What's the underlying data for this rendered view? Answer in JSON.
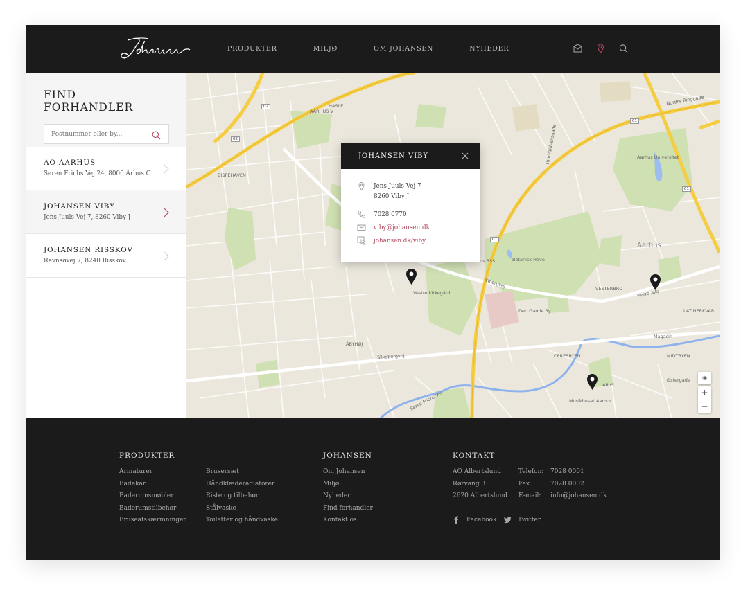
{
  "header": {
    "logo_text": "Johansen",
    "nav": [
      "PRODUKTER",
      "MILJØ",
      "OM JOHANSEN",
      "NYHEDER"
    ],
    "icons": [
      "mail-icon",
      "location-pin-icon",
      "search-icon"
    ],
    "accent_color": "#b2475c"
  },
  "sidebar": {
    "title": "FIND FORHANDLER",
    "search_placeholder": "Postnummer eller by...",
    "dealers": [
      {
        "name": "AO AARHUS",
        "address": "Søren Frichs Vej 24, 8000 Århus C"
      },
      {
        "name": "JOHANSEN VIBY",
        "address": "Jens Juuls Vej 7, 8260 Viby J"
      },
      {
        "name": "JOHANSEN RISSKOV",
        "address": "Ravnsøvej 7, 8240 Risskov"
      }
    ]
  },
  "popup": {
    "title": "JOHANSEN VIBY",
    "street": "Jens Juuls Vej 7",
    "city": "8260 Viby J",
    "phone": "7028 0770",
    "email": "viby@johansen.dk",
    "web": "johansen.dk/viby"
  },
  "map": {
    "labels": {
      "aarhus_v": "AARHUS V",
      "hasle": "HASLE",
      "bispehaven": "BISPEHAVEN",
      "aarhus": "Aarhus",
      "vesterbro": "VESTERBRO",
      "latinerkvarteret": "LATINERKVAR",
      "midtbyen": "MIDTBYEN",
      "ceresbyen": "CERESBYEN",
      "aabyhoj": "ÅBYHØJ",
      "vestre_kirkegaard": "Vestre Kirkegård",
      "botanisk_have": "Botanisk Have",
      "den_gamle_by": "Den Gamle By",
      "aros": "ARoS",
      "musikhuset": "Musikhuset Aarhus",
      "magasin": "Magasin",
      "aarhus_uni": "Aarhus Universitet",
      "aarhus_bss": "Aarhus BSS",
      "silkeborgvej": "Silkeborgvej",
      "viborgvej": "Viborgvej",
      "norre_alle": "Nørre Alle",
      "road_02a": "02",
      "road_02b": "02",
      "road_01a": "01",
      "road_01b": "01",
      "road_01c": "01",
      "ringgade": "Nordre Ringgade",
      "ostergade": "Østergade",
      "frichs": "Søren Frichs Vej",
      "thorvaldsensgade": "Thorvaldsensgade"
    },
    "zoom": {
      "locate": "◉",
      "plus": "+",
      "minus": "−"
    }
  },
  "footer": {
    "produkter_title": "PRODUKTER",
    "produkter_col1": [
      "Armaturer",
      "Badekar",
      "Baderumsmøbler",
      "Baderumstilbehør",
      "Bruseafskærmninger"
    ],
    "produkter_col2": [
      "Brusersæt",
      "Håndklæderadiatorer",
      "Riste og tilbehør",
      "Stålvaske",
      "Toiletter og håndvaske"
    ],
    "johansen_title": "JOHANSEN",
    "johansen_links": [
      "Om Johansen",
      "Miljø",
      "Nyheder",
      "Find forhandler",
      "Kontakt os"
    ],
    "kontakt_title": "KONTAKT",
    "address": [
      "AO Albertslund",
      "Rørvang 3",
      "2620 Albertslund"
    ],
    "contact_labels": [
      "Telefon:",
      "Fax:",
      "E-mail:"
    ],
    "contact_values": [
      "7028 0001",
      "7028 0002",
      "info@johansen.dk"
    ],
    "facebook": "Facebook",
    "twitter": "Twitter"
  }
}
